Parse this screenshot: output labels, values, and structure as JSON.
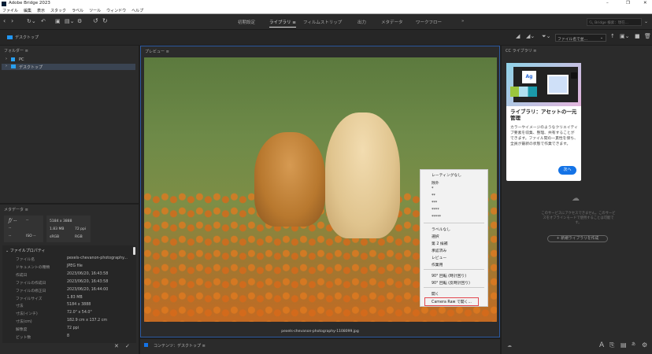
{
  "window": {
    "title": "Adobe Bridge 2023",
    "controls": [
      "–",
      "❐",
      "✕"
    ]
  },
  "menu": [
    "ファイル",
    "編集",
    "表示",
    "スタック",
    "ラベル",
    "ツール",
    "ウィンドウ",
    "ヘルプ"
  ],
  "workspaces": [
    "初期設定",
    "ライブラリ ≡",
    "フィルムストリップ",
    "出力",
    "メタデータ",
    "ワークフロー"
  ],
  "more": "»",
  "search": {
    "placeholder": "Bridge 検索：現在..."
  },
  "path": {
    "label": "デスクトップ"
  },
  "sort": {
    "value": "ファイル名で並..."
  },
  "folders": {
    "title": "フォルダー ≡",
    "items": [
      {
        "label": "PC"
      },
      {
        "label": "デスクトップ",
        "selected": true
      }
    ]
  },
  "preview": {
    "title": "プレビュー ≡",
    "filename": "pexels-chevanon-photography-1108099.jpg"
  },
  "metadata": {
    "title": "メタデータ ≡",
    "camera": {
      "f": "ƒ/ --",
      "shutter": "--",
      "a": "--",
      "b": "--",
      "c": "--",
      "iso": "ISO --"
    },
    "file": {
      "dims": "5184 x 3888",
      "size": "1.83 MB",
      "ppi": "72 ppi",
      "space": "sRGB",
      "mode": "RGB"
    },
    "section": "ファイルプロパティ",
    "rows": [
      {
        "k": "ファイル名",
        "v": "pexels-chevanon-photography..."
      },
      {
        "k": "ドキュメントの種類",
        "v": "JPEG file"
      },
      {
        "k": "作成日",
        "v": "2023/06/20, 16:43:58"
      },
      {
        "k": "ファイルの作成日",
        "v": "2023/06/20, 16:43:58"
      },
      {
        "k": "ファイルの修正日",
        "v": "2023/06/20, 16:44:00"
      },
      {
        "k": "ファイルサイズ",
        "v": "1.83 MB"
      },
      {
        "k": "寸法",
        "v": "5184 x 3888"
      },
      {
        "k": "寸法(インチ)",
        "v": "72.0\" x 54.0\""
      },
      {
        "k": "寸法(cm)",
        "v": "182.9 cm x 137.2 cm"
      },
      {
        "k": "解像度",
        "v": "72 ppi"
      },
      {
        "k": "ビット数",
        "v": "8"
      }
    ]
  },
  "content": {
    "title": "コンテンツ：デスクトップ ≡"
  },
  "context_menu": [
    "レーティングなし",
    "除外",
    "*",
    "**",
    "***",
    "****",
    "*****",
    "ラベルなし",
    "選択",
    "第 2 候補",
    "承認済み",
    "レビュー",
    "作業用",
    "90° 回転 (時計回り)",
    "90° 回転 (反時計回り)",
    "開く",
    "Camera Raw で開く..."
  ],
  "library": {
    "title": "CC ライブラリ ≡",
    "card_title": "ライブラリ：アセットの一元管理",
    "card_body": "カラーやイメージのようなクリエイティブ要素を収集、整理、共有することができます。ファイル間の一貫性を保ち、全員が最新の状態で作業できます。",
    "next": "次へ",
    "offline": "このサービスにアクセスできません。このサービスをオフラインモードで使用することは可能です。",
    "create": "+ 新規ライブラリを作成",
    "ag": "Ag"
  },
  "colors": {
    "accent": "#1473e6",
    "highlight": "#e34850"
  }
}
